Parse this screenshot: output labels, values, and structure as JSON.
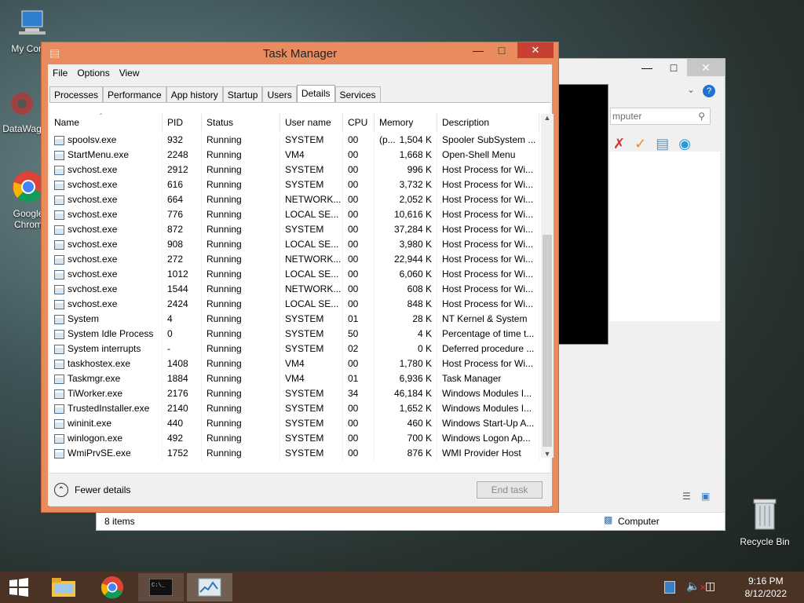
{
  "desktop": {
    "icons": [
      {
        "label": "My Comp",
        "icon": "computer-icon"
      },
      {
        "label": "DataWag",
        "icon": "gear-icon"
      },
      {
        "label": "Google Chrom",
        "icon": "chrome-icon"
      },
      {
        "label": "Recycle Bin",
        "icon": "recycle-bin-icon"
      }
    ]
  },
  "explorer": {
    "search_placeholder": "mputer",
    "status_items": "8 items",
    "status_location": "Computer"
  },
  "task_manager": {
    "title": "Task Manager",
    "menu": [
      "File",
      "Options",
      "View"
    ],
    "tabs": [
      "Processes",
      "Performance",
      "App history",
      "Startup",
      "Users",
      "Details",
      "Services"
    ],
    "active_tab": "Details",
    "columns": [
      "Name",
      "PID",
      "Status",
      "User name",
      "CPU",
      "Memory (p...",
      "Description"
    ],
    "rows": [
      {
        "name": "spoolsv.exe",
        "pid": "932",
        "status": "Running",
        "user": "SYSTEM",
        "cpu": "00",
        "mem": "1,504 K",
        "desc": "Spooler SubSystem ..."
      },
      {
        "name": "StartMenu.exe",
        "pid": "2248",
        "status": "Running",
        "user": "VM4",
        "cpu": "00",
        "mem": "1,668 K",
        "desc": "Open-Shell Menu"
      },
      {
        "name": "svchost.exe",
        "pid": "2912",
        "status": "Running",
        "user": "SYSTEM",
        "cpu": "00",
        "mem": "996 K",
        "desc": "Host Process for Wi..."
      },
      {
        "name": "svchost.exe",
        "pid": "616",
        "status": "Running",
        "user": "SYSTEM",
        "cpu": "00",
        "mem": "3,732 K",
        "desc": "Host Process for Wi..."
      },
      {
        "name": "svchost.exe",
        "pid": "664",
        "status": "Running",
        "user": "NETWORK...",
        "cpu": "00",
        "mem": "2,052 K",
        "desc": "Host Process for Wi..."
      },
      {
        "name": "svchost.exe",
        "pid": "776",
        "status": "Running",
        "user": "LOCAL SE...",
        "cpu": "00",
        "mem": "10,616 K",
        "desc": "Host Process for Wi..."
      },
      {
        "name": "svchost.exe",
        "pid": "872",
        "status": "Running",
        "user": "SYSTEM",
        "cpu": "00",
        "mem": "37,284 K",
        "desc": "Host Process for Wi..."
      },
      {
        "name": "svchost.exe",
        "pid": "908",
        "status": "Running",
        "user": "LOCAL SE...",
        "cpu": "00",
        "mem": "3,980 K",
        "desc": "Host Process for Wi..."
      },
      {
        "name": "svchost.exe",
        "pid": "272",
        "status": "Running",
        "user": "NETWORK...",
        "cpu": "00",
        "mem": "22,944 K",
        "desc": "Host Process for Wi..."
      },
      {
        "name": "svchost.exe",
        "pid": "1012",
        "status": "Running",
        "user": "LOCAL SE...",
        "cpu": "00",
        "mem": "6,060 K",
        "desc": "Host Process for Wi..."
      },
      {
        "name": "svchost.exe",
        "pid": "1544",
        "status": "Running",
        "user": "NETWORK...",
        "cpu": "00",
        "mem": "608 K",
        "desc": "Host Process for Wi..."
      },
      {
        "name": "svchost.exe",
        "pid": "2424",
        "status": "Running",
        "user": "LOCAL SE...",
        "cpu": "00",
        "mem": "848 K",
        "desc": "Host Process for Wi..."
      },
      {
        "name": "System",
        "pid": "4",
        "status": "Running",
        "user": "SYSTEM",
        "cpu": "01",
        "mem": "28 K",
        "desc": "NT Kernel & System"
      },
      {
        "name": "System Idle Process",
        "pid": "0",
        "status": "Running",
        "user": "SYSTEM",
        "cpu": "50",
        "mem": "4 K",
        "desc": "Percentage of time t..."
      },
      {
        "name": "System interrupts",
        "pid": "-",
        "status": "Running",
        "user": "SYSTEM",
        "cpu": "02",
        "mem": "0 K",
        "desc": "Deferred procedure ..."
      },
      {
        "name": "taskhostex.exe",
        "pid": "1408",
        "status": "Running",
        "user": "VM4",
        "cpu": "00",
        "mem": "1,780 K",
        "desc": "Host Process for Wi..."
      },
      {
        "name": "Taskmgr.exe",
        "pid": "1884",
        "status": "Running",
        "user": "VM4",
        "cpu": "01",
        "mem": "6,936 K",
        "desc": "Task Manager"
      },
      {
        "name": "TiWorker.exe",
        "pid": "2176",
        "status": "Running",
        "user": "SYSTEM",
        "cpu": "34",
        "mem": "46,184 K",
        "desc": "Windows Modules I..."
      },
      {
        "name": "TrustedInstaller.exe",
        "pid": "2140",
        "status": "Running",
        "user": "SYSTEM",
        "cpu": "00",
        "mem": "1,652 K",
        "desc": "Windows Modules I..."
      },
      {
        "name": "wininit.exe",
        "pid": "440",
        "status": "Running",
        "user": "SYSTEM",
        "cpu": "00",
        "mem": "460 K",
        "desc": "Windows Start-Up A..."
      },
      {
        "name": "winlogon.exe",
        "pid": "492",
        "status": "Running",
        "user": "SYSTEM",
        "cpu": "00",
        "mem": "700 K",
        "desc": "Windows Logon Ap..."
      },
      {
        "name": "WmiPrvSE.exe",
        "pid": "1752",
        "status": "Running",
        "user": "SYSTEM",
        "cpu": "00",
        "mem": "876 K",
        "desc": "WMI Provider Host"
      }
    ],
    "fewer_details": "Fewer details",
    "end_task": "End task"
  },
  "taskbar": {
    "time": "9:16 PM",
    "date": "8/12/2022",
    "pinned": [
      "start-icon",
      "file-explorer-icon",
      "chrome-icon",
      "command-prompt-icon",
      "task-manager-icon"
    ]
  },
  "colors": {
    "tm_frame": "#e88c5e",
    "close_button": "#c74132",
    "taskbar": "#4a3224"
  }
}
